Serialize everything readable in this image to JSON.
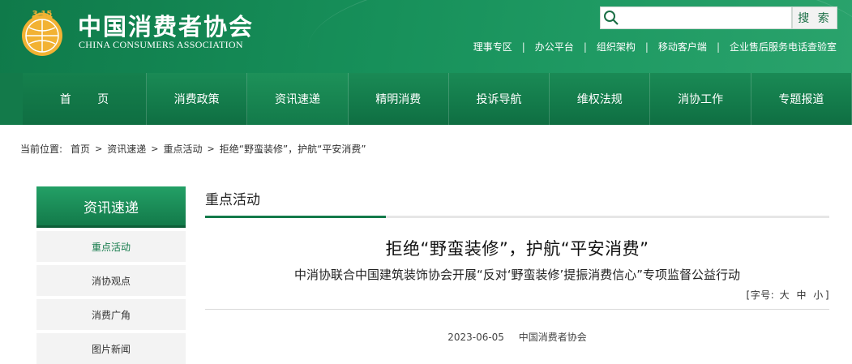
{
  "header": {
    "logo_cn": "中国消费者协会",
    "logo_en": "CHINA CONSUMERS ASSOCIATION",
    "logo_emblem_text": "3·15",
    "search": {
      "placeholder": "",
      "button_label": "搜 索"
    },
    "top_links": [
      "理事专区",
      "办公平台",
      "组织架构",
      "移动客户端",
      "企业售后服务电话查验室"
    ]
  },
  "nav": {
    "items": [
      "首 页",
      "消费政策",
      "资讯速递",
      "精明消费",
      "投诉导航",
      "维权法规",
      "消协工作",
      "专题报道"
    ],
    "active_index": 2
  },
  "breadcrumb": {
    "prefix": "当前位置:",
    "items": [
      "首页",
      "资讯速递",
      "重点活动",
      "拒绝“野蛮装修”，护航“平安消费”"
    ]
  },
  "sidebar": {
    "title": "资讯速递",
    "items": [
      "重点活动",
      "消协观点",
      "消费广角",
      "图片新闻"
    ],
    "active_index": 0
  },
  "main": {
    "section_title": "重点活动",
    "article": {
      "title": "拒绝“野蛮装修”，护航“平安消费”",
      "subtitle": "中消协联合中国建筑装饰协会开展“反对‘野蛮装修’提振消费信心”专项监督公益行动",
      "font_size_label": "[字号:",
      "font_sizes": [
        "大",
        "中",
        "小"
      ],
      "font_size_end": "]",
      "date": "2023-06-05",
      "source": "中国消费者协会"
    }
  },
  "colors": {
    "brand_green": "#137a4a",
    "header_green": "#17905a",
    "logo_gold": "#f2b233"
  }
}
